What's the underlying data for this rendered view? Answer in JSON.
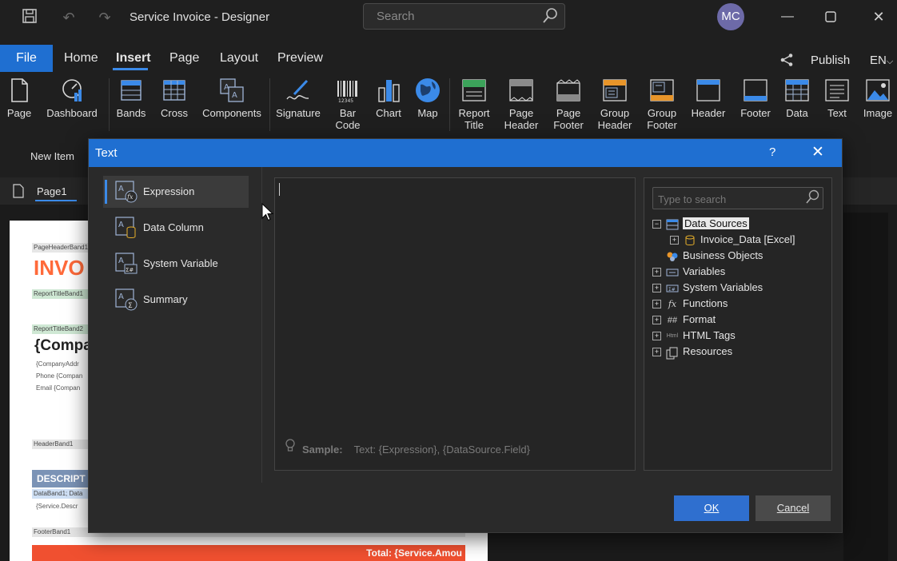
{
  "titlebar": {
    "doc_title": "Service Invoice  - Designer",
    "search_placeholder": "Search",
    "avatar_initials": "MC"
  },
  "ribbon_tabs": {
    "file": "File",
    "tabs": [
      {
        "label": "Home"
      },
      {
        "label": "Insert"
      },
      {
        "label": "Page"
      },
      {
        "label": "Layout"
      },
      {
        "label": "Preview"
      }
    ],
    "active_tab": "Insert",
    "publish": "Publish",
    "language": "EN"
  },
  "ribbon_items": [
    {
      "label": "Page",
      "icon": "page-icon"
    },
    {
      "label": "Dashboard",
      "icon": "dashboard-icon"
    },
    {
      "label": "Bands",
      "icon": "bands-icon"
    },
    {
      "label": "Cross",
      "icon": "cross-icon"
    },
    {
      "label": "Components",
      "icon": "components-icon"
    },
    {
      "label": "Signature",
      "icon": "signature-icon"
    },
    {
      "label": "Bar Code",
      "icon": "barcode-icon"
    },
    {
      "label": "Chart",
      "icon": "chart-icon"
    },
    {
      "label": "Map",
      "icon": "map-icon"
    },
    {
      "label": "Report Title",
      "icon": "report-title-icon"
    },
    {
      "label": "Page Header",
      "icon": "page-header-icon"
    },
    {
      "label": "Page Footer",
      "icon": "page-footer-icon"
    },
    {
      "label": "Group Header",
      "icon": "group-header-icon"
    },
    {
      "label": "Group Footer",
      "icon": "group-footer-icon"
    },
    {
      "label": "Header",
      "icon": "header-icon"
    },
    {
      "label": "Footer",
      "icon": "footer-icon"
    },
    {
      "label": "Data",
      "icon": "data-icon"
    },
    {
      "label": "Text",
      "icon": "text-icon"
    },
    {
      "label": "Image",
      "icon": "image-icon"
    }
  ],
  "new_item": "New Item",
  "page_tab": "Page1",
  "canvas": {
    "bands": {
      "page_header": "PageHeaderBand1",
      "report_title1": "ReportTitleBand1",
      "report_title2": "ReportTitleBand2",
      "header": "HeaderBand1",
      "data": "DataBand1; Data",
      "footer": "FooterBand1"
    },
    "invoice_title": "INVO",
    "company": "{Compa",
    "company_address": "{CompanyAddr",
    "phone": "Phone {Compan",
    "email": "Email {Compan",
    "description_header": "DESCRIPT",
    "service_field": "{Service.Descr",
    "total_label": "Total:",
    "total_value": "{Service.Amou"
  },
  "dialog": {
    "title": "Text",
    "help": "?",
    "close": "✕",
    "nav": [
      {
        "label": "Expression",
        "icon": "expression-icon"
      },
      {
        "label": "Data Column",
        "icon": "data-column-icon"
      },
      {
        "label": "System Variable",
        "icon": "system-variable-icon"
      },
      {
        "label": "Summary",
        "icon": "summary-icon"
      }
    ],
    "active_nav": "Expression",
    "sample_label": "Sample:",
    "sample_text": "Text: {Expression},   {DataSource.Field}",
    "tree_search_placeholder": "Type to search",
    "tree": [
      {
        "label": "Data Sources",
        "toggle": "−",
        "icon": "datasources-icon",
        "level": 0,
        "selected": true
      },
      {
        "label": "Invoice_Data [Excel]",
        "toggle": "+",
        "icon": "database-icon",
        "level": 1,
        "selected": false
      },
      {
        "label": "Business Objects",
        "toggle": "",
        "icon": "business-objects-icon",
        "level": 0,
        "selected": false
      },
      {
        "label": "Variables",
        "toggle": "+",
        "icon": "variables-icon",
        "level": 0,
        "selected": false
      },
      {
        "label": "System Variables",
        "toggle": "+",
        "icon": "system-variables-icon",
        "level": 0,
        "selected": false
      },
      {
        "label": "Functions",
        "toggle": "+",
        "icon": "functions-icon",
        "level": 0,
        "selected": false
      },
      {
        "label": "Format",
        "toggle": "+",
        "icon": "format-icon",
        "level": 0,
        "selected": false
      },
      {
        "label": "HTML Tags",
        "toggle": "+",
        "icon": "html-tags-icon",
        "level": 0,
        "selected": false
      },
      {
        "label": "Resources",
        "toggle": "+",
        "icon": "resources-icon",
        "level": 0,
        "selected": false
      }
    ],
    "ok": "OK",
    "cancel": "Cancel"
  },
  "colors": {
    "accent": "#1f6fd1",
    "ok_button": "#2f6fcf",
    "invoice_orange": "#ff6a3a",
    "total_bar": "#f05030"
  }
}
